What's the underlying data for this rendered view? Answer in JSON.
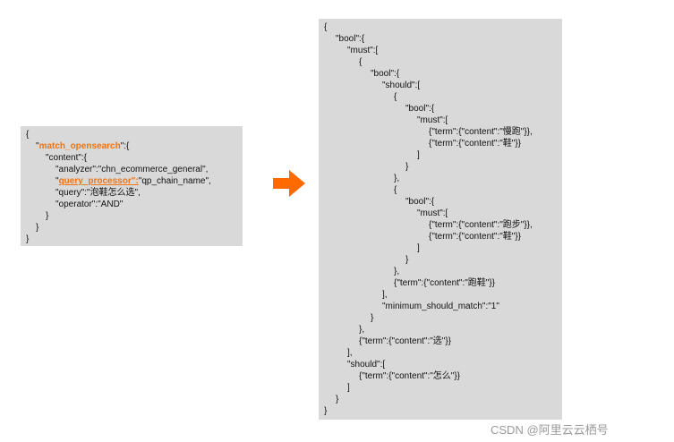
{
  "left_query": {
    "lines": [
      {
        "indent": 0,
        "pre": "{",
        "key": "",
        "post": ""
      },
      {
        "indent": 1,
        "pre": "\"",
        "key": "match_opensearch",
        "post": "\":{",
        "style": "hl"
      },
      {
        "indent": 2,
        "pre": "\"content\":{",
        "key": "",
        "post": ""
      },
      {
        "indent": 3,
        "pre": "\"analyzer\":\"chn_ecommerce_general\",",
        "key": "",
        "post": ""
      },
      {
        "indent": 3,
        "pre": "\"",
        "key": "query_processor\":",
        "post": "\"qp_chain_name\",",
        "style": "hl-u"
      },
      {
        "indent": 3,
        "pre": "\"query\":\"泡鞋怎么选\",",
        "key": "",
        "post": ""
      },
      {
        "indent": 3,
        "pre": "\"operator\":\"AND\"",
        "key": "",
        "post": ""
      },
      {
        "indent": 2,
        "pre": "}",
        "key": "",
        "post": ""
      },
      {
        "indent": 1,
        "pre": "}",
        "key": "",
        "post": ""
      },
      {
        "indent": 0,
        "pre": "}",
        "key": "",
        "post": ""
      }
    ]
  },
  "right_query": {
    "lines": [
      {
        "indent": 0,
        "text": "{"
      },
      {
        "indent": 1,
        "text": "\"bool\":{"
      },
      {
        "indent": 2,
        "text": "\"must\":["
      },
      {
        "indent": 3,
        "text": "{"
      },
      {
        "indent": 4,
        "text": "\"bool\":{"
      },
      {
        "indent": 5,
        "text": "\"should\":["
      },
      {
        "indent": 6,
        "text": "{"
      },
      {
        "indent": 7,
        "text": "\"bool\":{"
      },
      {
        "indent": 8,
        "text": "\"must\":["
      },
      {
        "indent": 9,
        "text": "{\"term\":{\"content\":\"慢跑\"}},"
      },
      {
        "indent": 9,
        "text": "{\"term\":{\"content\":\"鞋\"}}"
      },
      {
        "indent": 8,
        "text": "]"
      },
      {
        "indent": 7,
        "text": "}"
      },
      {
        "indent": 6,
        "text": "},"
      },
      {
        "indent": 6,
        "text": "{"
      },
      {
        "indent": 7,
        "text": "\"bool\":{"
      },
      {
        "indent": 8,
        "text": "\"must\":["
      },
      {
        "indent": 9,
        "text": "{\"term\":{\"content\":\"跑步\"}},"
      },
      {
        "indent": 9,
        "text": "{\"term\":{\"content\":\"鞋\"}}"
      },
      {
        "indent": 8,
        "text": "]"
      },
      {
        "indent": 7,
        "text": "}"
      },
      {
        "indent": 6,
        "text": "},"
      },
      {
        "indent": 6,
        "text": "{\"term\":{\"content\":\"跑鞋\"}}"
      },
      {
        "indent": 5,
        "text": "],"
      },
      {
        "indent": 5,
        "text": "\"minimum_should_match\":\"1\""
      },
      {
        "indent": 4,
        "text": "}"
      },
      {
        "indent": 3,
        "text": "},"
      },
      {
        "indent": 3,
        "text": "{\"term\":{\"content\":\"选\"}}"
      },
      {
        "indent": 2,
        "text": "],"
      },
      {
        "indent": 2,
        "text": "\"should\":["
      },
      {
        "indent": 3,
        "text": "{\"term\":{\"content\":\"怎么\"}}"
      },
      {
        "indent": 2,
        "text": "]"
      },
      {
        "indent": 1,
        "text": "}"
      },
      {
        "indent": 0,
        "text": "}"
      }
    ]
  },
  "arrow": {
    "icon": "right-arrow-icon",
    "color": "#ff6a00"
  },
  "watermark": "CSDN @阿里云云栖号",
  "colors": {
    "highlight": "#f07314",
    "box": "#d9d9d9"
  }
}
